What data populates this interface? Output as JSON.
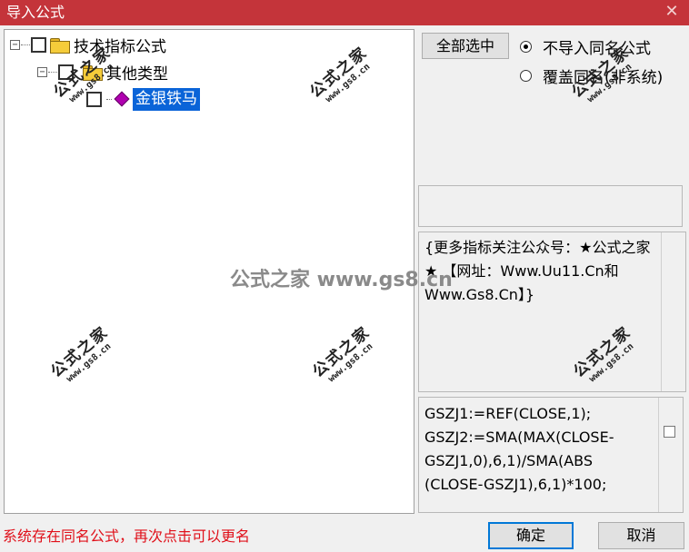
{
  "window": {
    "title": "导入公式",
    "close_glyph": "✕"
  },
  "tree": {
    "root": {
      "label": "技术指标公式",
      "expander": "⊟"
    },
    "group": {
      "label": "其他类型",
      "expander": "⊟"
    },
    "leaf": {
      "label": "金银铁马"
    }
  },
  "options": {
    "select_all_label": "全部选中",
    "radio_no_import": "不导入同名公式",
    "radio_overwrite": "覆盖同名(非系统)",
    "selected_radio": "no_import"
  },
  "info_text": "{更多指标关注公众号：★公式之家★ 【网址：Www.Uu11.Cn和Www.Gs8.Cn】}",
  "code_text": "GSZJ1:=REF(CLOSE,1);\nGSZJ2:=SMA(MAX(CLOSE-GSZJ1,0),6,1)/SMA(ABS\n(CLOSE-GSZJ1),6,1)*100;",
  "status_text": "系统存在同名公式，再次点击可以更名",
  "buttons": {
    "ok_label": "确定",
    "cancel_label": "取消"
  },
  "watermark": {
    "center_text": "公式之家 www.gs8.cn",
    "stamp_cn": "公式之家",
    "stamp_url": "www.gs8.cn"
  },
  "colors": {
    "titlebar": "#c4343a",
    "selection": "#0a64d8",
    "status_text": "#e0101a"
  }
}
